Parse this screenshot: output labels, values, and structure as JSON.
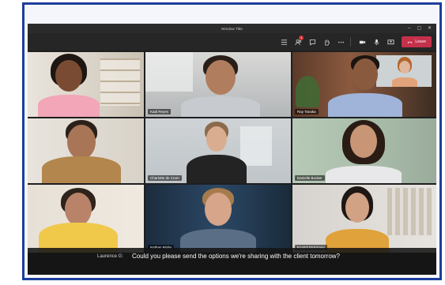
{
  "window": {
    "title": "Window Title",
    "controls": [
      "–",
      "▢",
      "✕"
    ]
  },
  "toolbar": {
    "items": [
      {
        "name": "more-options-grid-icon"
      },
      {
        "name": "participants-icon",
        "badge": "1"
      },
      {
        "name": "chat-icon"
      },
      {
        "name": "raise-hand-icon"
      },
      {
        "name": "ellipsis-icon"
      }
    ],
    "media": [
      {
        "name": "camera-icon"
      },
      {
        "name": "microphone-icon"
      },
      {
        "name": "share-screen-icon"
      }
    ],
    "leave_label": "Leave",
    "colors": {
      "leave": "#c4314b"
    }
  },
  "participants": [
    {
      "name": ""
    },
    {
      "name": "Kadi Reyes"
    },
    {
      "name": "Ray Tanaka"
    },
    {
      "name": ""
    },
    {
      "name": "Charlotte de Crum"
    },
    {
      "name": "Danielle Booker"
    },
    {
      "name": ""
    },
    {
      "name": "Nathan Rigby"
    },
    {
      "name": "Krystal McKinney"
    }
  ],
  "caption": {
    "speaker": "Laurence G:",
    "text": "Could you please send the options we're sharing with the client tomorrow?"
  }
}
